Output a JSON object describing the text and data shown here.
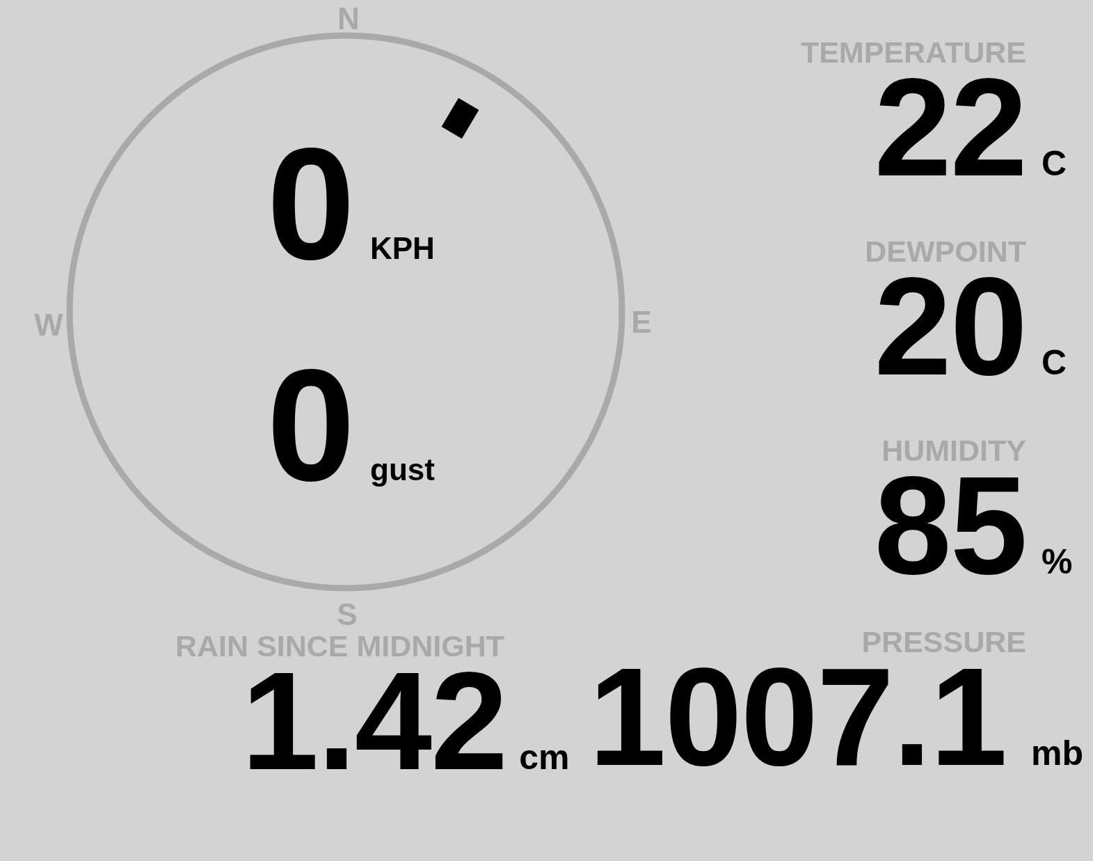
{
  "compass": {
    "cardinals": [
      "N",
      "E",
      "S",
      "W"
    ],
    "speed": {
      "value": "0",
      "unit": "KPH"
    },
    "gust": {
      "value": "0",
      "unit": "gust"
    }
  },
  "readings": [
    {
      "label": "TEMPERATURE",
      "value": "22",
      "unit": "C"
    },
    {
      "label": "DEWPOINT",
      "value": "20",
      "unit": "C"
    },
    {
      "label": "HUMIDITY",
      "value": "85",
      "unit": "%"
    }
  ],
  "rain": {
    "label": "RAIN SINCE MIDNIGHT",
    "value": "1.42",
    "unit": "cm"
  },
  "pressure": {
    "label": "PRESSURE",
    "value": "1007.1",
    "unit": "mb"
  }
}
